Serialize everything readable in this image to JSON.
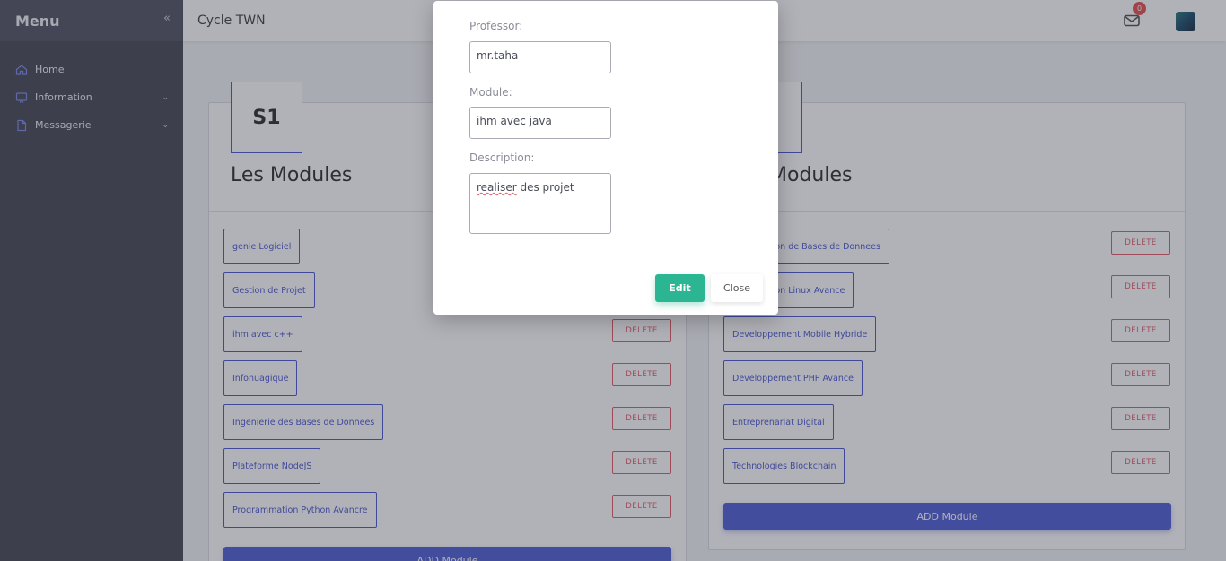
{
  "sidebar": {
    "title": "Menu",
    "collapse_icon": "double-chevron-left-icon",
    "items": [
      {
        "label": "Home",
        "icon": "home-icon"
      },
      {
        "label": "Information",
        "icon": "monitor-icon",
        "has_submenu": true
      },
      {
        "label": "Messagerie",
        "icon": "document-icon",
        "has_submenu": true
      }
    ]
  },
  "topbar": {
    "title": "Cycle TWN",
    "mail_count": "0"
  },
  "left_card": {
    "semester": "S1",
    "title": "Les Modules",
    "modules": [
      "genie Logiciel",
      "Gestion de Projet",
      "ihm avec c++",
      "Infonuagique",
      "Ingenierie des Bases de Donnees",
      "Plateforme NodeJS",
      "Programmation Python Avancre"
    ],
    "delete_label": "DELETE",
    "add_label": "ADD Module"
  },
  "right_card": {
    "title": "Modules",
    "modules": [
      "tion de Bases de Donnees",
      "tion Linux Avance",
      "Developpement Mobile Hybride",
      "Developpement PHP Avance",
      "Entreprenariat Digital",
      "Technologies Blockchain"
    ],
    "delete_label": "DELETE",
    "add_label": "ADD Module"
  },
  "modal": {
    "professor_label": "Professor:",
    "professor_value": "mr.taha",
    "module_label": "Module:",
    "module_value": "ihm avec java",
    "description_label": "Description:",
    "description_misspelled": "realiser",
    "description_rest": " des projet",
    "edit_label": "Edit",
    "close_label": "Close"
  },
  "colors": {
    "sidebar": "#4a4b57",
    "accent": "#4e5ad1",
    "danger": "#e35d6a",
    "success": "#2cb592"
  }
}
